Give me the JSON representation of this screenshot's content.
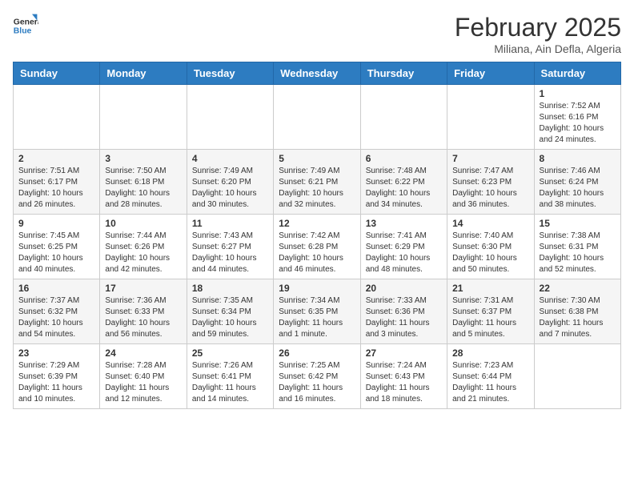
{
  "header": {
    "logo_line1": "General",
    "logo_line2": "Blue",
    "month": "February 2025",
    "location": "Miliana, Ain Defla, Algeria"
  },
  "days_of_week": [
    "Sunday",
    "Monday",
    "Tuesday",
    "Wednesday",
    "Thursday",
    "Friday",
    "Saturday"
  ],
  "weeks": [
    [
      {
        "day": "",
        "info": ""
      },
      {
        "day": "",
        "info": ""
      },
      {
        "day": "",
        "info": ""
      },
      {
        "day": "",
        "info": ""
      },
      {
        "day": "",
        "info": ""
      },
      {
        "day": "",
        "info": ""
      },
      {
        "day": "1",
        "info": "Sunrise: 7:52 AM\nSunset: 6:16 PM\nDaylight: 10 hours and 24 minutes."
      }
    ],
    [
      {
        "day": "2",
        "info": "Sunrise: 7:51 AM\nSunset: 6:17 PM\nDaylight: 10 hours and 26 minutes."
      },
      {
        "day": "3",
        "info": "Sunrise: 7:50 AM\nSunset: 6:18 PM\nDaylight: 10 hours and 28 minutes."
      },
      {
        "day": "4",
        "info": "Sunrise: 7:49 AM\nSunset: 6:20 PM\nDaylight: 10 hours and 30 minutes."
      },
      {
        "day": "5",
        "info": "Sunrise: 7:49 AM\nSunset: 6:21 PM\nDaylight: 10 hours and 32 minutes."
      },
      {
        "day": "6",
        "info": "Sunrise: 7:48 AM\nSunset: 6:22 PM\nDaylight: 10 hours and 34 minutes."
      },
      {
        "day": "7",
        "info": "Sunrise: 7:47 AM\nSunset: 6:23 PM\nDaylight: 10 hours and 36 minutes."
      },
      {
        "day": "8",
        "info": "Sunrise: 7:46 AM\nSunset: 6:24 PM\nDaylight: 10 hours and 38 minutes."
      }
    ],
    [
      {
        "day": "9",
        "info": "Sunrise: 7:45 AM\nSunset: 6:25 PM\nDaylight: 10 hours and 40 minutes."
      },
      {
        "day": "10",
        "info": "Sunrise: 7:44 AM\nSunset: 6:26 PM\nDaylight: 10 hours and 42 minutes."
      },
      {
        "day": "11",
        "info": "Sunrise: 7:43 AM\nSunset: 6:27 PM\nDaylight: 10 hours and 44 minutes."
      },
      {
        "day": "12",
        "info": "Sunrise: 7:42 AM\nSunset: 6:28 PM\nDaylight: 10 hours and 46 minutes."
      },
      {
        "day": "13",
        "info": "Sunrise: 7:41 AM\nSunset: 6:29 PM\nDaylight: 10 hours and 48 minutes."
      },
      {
        "day": "14",
        "info": "Sunrise: 7:40 AM\nSunset: 6:30 PM\nDaylight: 10 hours and 50 minutes."
      },
      {
        "day": "15",
        "info": "Sunrise: 7:38 AM\nSunset: 6:31 PM\nDaylight: 10 hours and 52 minutes."
      }
    ],
    [
      {
        "day": "16",
        "info": "Sunrise: 7:37 AM\nSunset: 6:32 PM\nDaylight: 10 hours and 54 minutes."
      },
      {
        "day": "17",
        "info": "Sunrise: 7:36 AM\nSunset: 6:33 PM\nDaylight: 10 hours and 56 minutes."
      },
      {
        "day": "18",
        "info": "Sunrise: 7:35 AM\nSunset: 6:34 PM\nDaylight: 10 hours and 59 minutes."
      },
      {
        "day": "19",
        "info": "Sunrise: 7:34 AM\nSunset: 6:35 PM\nDaylight: 11 hours and 1 minute."
      },
      {
        "day": "20",
        "info": "Sunrise: 7:33 AM\nSunset: 6:36 PM\nDaylight: 11 hours and 3 minutes."
      },
      {
        "day": "21",
        "info": "Sunrise: 7:31 AM\nSunset: 6:37 PM\nDaylight: 11 hours and 5 minutes."
      },
      {
        "day": "22",
        "info": "Sunrise: 7:30 AM\nSunset: 6:38 PM\nDaylight: 11 hours and 7 minutes."
      }
    ],
    [
      {
        "day": "23",
        "info": "Sunrise: 7:29 AM\nSunset: 6:39 PM\nDaylight: 11 hours and 10 minutes."
      },
      {
        "day": "24",
        "info": "Sunrise: 7:28 AM\nSunset: 6:40 PM\nDaylight: 11 hours and 12 minutes."
      },
      {
        "day": "25",
        "info": "Sunrise: 7:26 AM\nSunset: 6:41 PM\nDaylight: 11 hours and 14 minutes."
      },
      {
        "day": "26",
        "info": "Sunrise: 7:25 AM\nSunset: 6:42 PM\nDaylight: 11 hours and 16 minutes."
      },
      {
        "day": "27",
        "info": "Sunrise: 7:24 AM\nSunset: 6:43 PM\nDaylight: 11 hours and 18 minutes."
      },
      {
        "day": "28",
        "info": "Sunrise: 7:23 AM\nSunset: 6:44 PM\nDaylight: 11 hours and 21 minutes."
      },
      {
        "day": "",
        "info": ""
      }
    ]
  ]
}
